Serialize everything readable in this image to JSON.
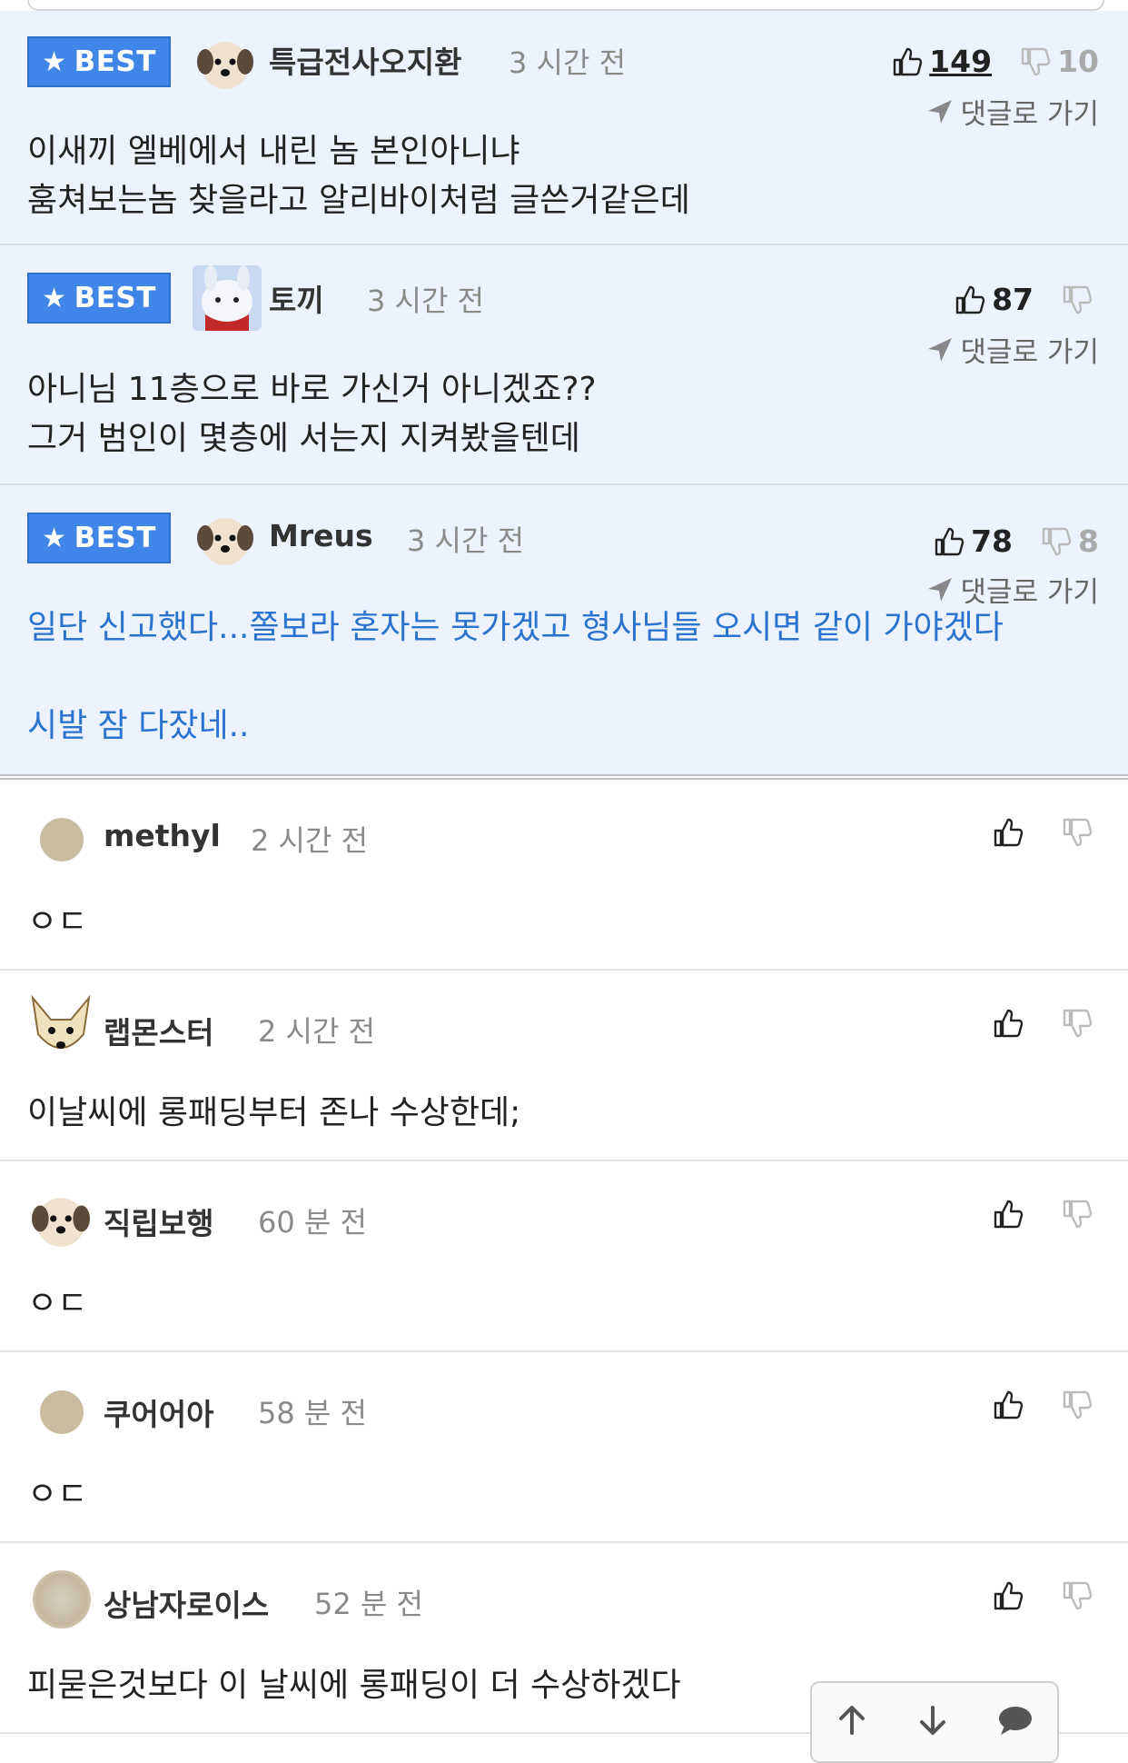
{
  "best_comments": [
    {
      "badge": "BEST",
      "nickname": "특급전사오지환",
      "time": "3 시간 전",
      "up_count": "149",
      "down_count": "10",
      "goto_label": "댓글로 가기",
      "text": "이새끼 엘베에서 내린 놈 본인아니냐\n훔쳐보는놈 찾을라고 알리바이처럼 글쓴거같은데",
      "avatar": "puppy-avatar"
    },
    {
      "badge": "BEST",
      "nickname": "토끼",
      "time": "3 시간 전",
      "up_count": "87",
      "down_count": "",
      "goto_label": "댓글로 가기",
      "text": "아니님 11층으로 바로 가신거 아니겠죠??\n그거 범인이 몇층에 서는지 지켜봤을텐데",
      "avatar": "bunny-avatar"
    },
    {
      "badge": "BEST",
      "nickname": "Mreus",
      "time": "3 시간 전",
      "up_count": "78",
      "down_count": "8",
      "goto_label": "댓글로 가기",
      "text": "일단 신고했다...쫄보라 혼자는 못가겠고 형사님들 오시면 같이 가야겠다\n\n시발 잠 다잤네..",
      "avatar": "puppy-avatar"
    }
  ],
  "comments": [
    {
      "nickname": "methyl",
      "time": "2 시간 전",
      "text": "ㅇㄷ",
      "avatar": "default-avatar"
    },
    {
      "nickname": "랩몬스터",
      "time": "2 시간 전",
      "text": "이날씨에 롱패딩부터 존나 수상한데;",
      "avatar": "chihuahua-avatar"
    },
    {
      "nickname": "직립보행",
      "time": "60 분 전",
      "text": "ㅇㄷ",
      "avatar": "puppy-avatar"
    },
    {
      "nickname": "쿠어어아",
      "time": "58 분 전",
      "text": "ㅇㄷ",
      "avatar": "default-avatar"
    },
    {
      "nickname": "상남자로이스",
      "time": "52 분 전",
      "text": "피묻은것보다 이 날씨에 롱패딩이 더 수상하겠다",
      "avatar": "blurred-avatar"
    }
  ],
  "float_nav": [
    "arrow-up-icon",
    "arrow-down-icon",
    "comment-bubble-icon"
  ],
  "colors": {
    "best_bg": "#edf3fe",
    "badge": "#3f86e8",
    "highlight_text": "#2a73cf"
  }
}
